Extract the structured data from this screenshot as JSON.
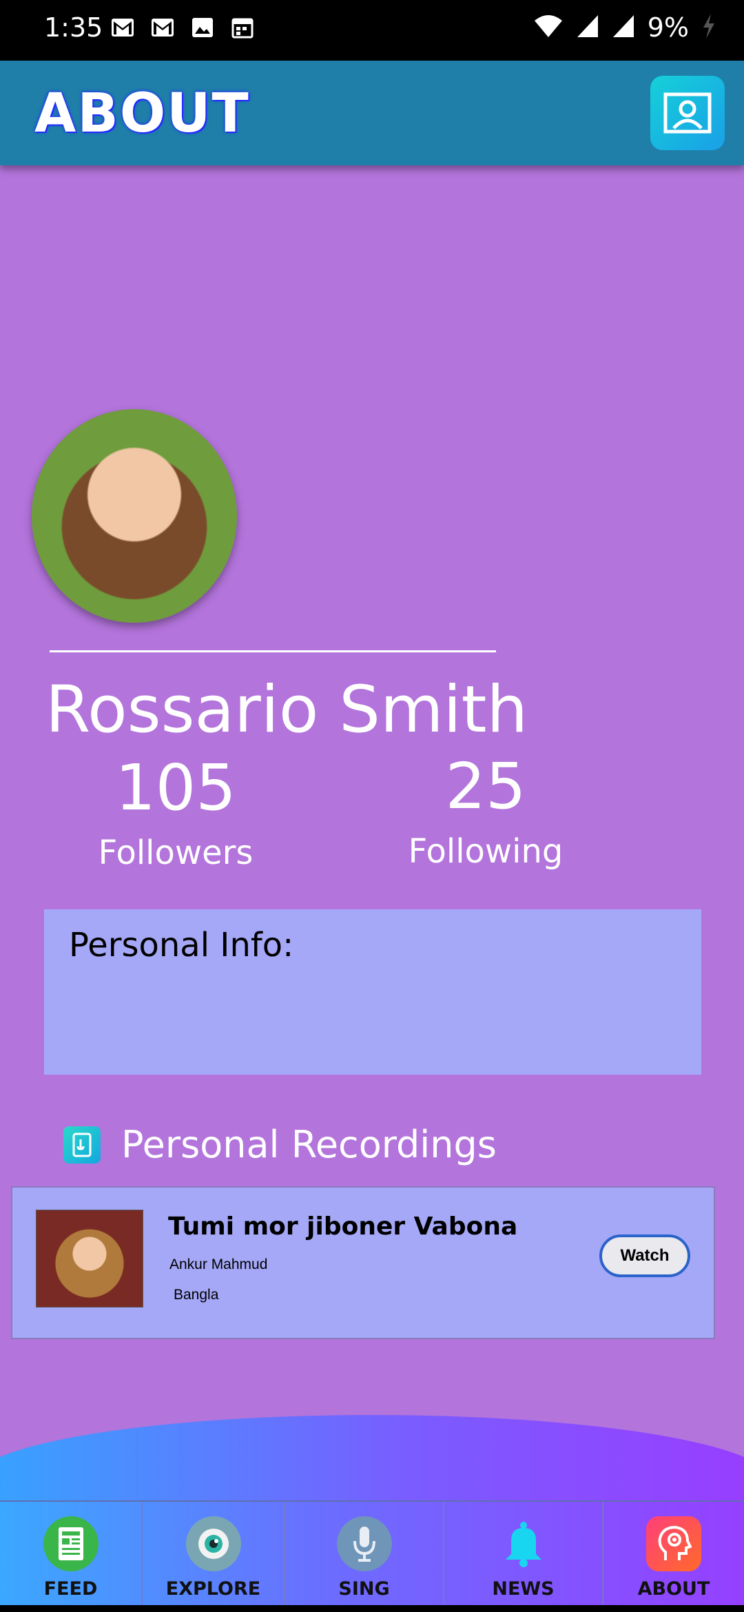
{
  "status_bar": {
    "time": "1:35",
    "battery": "9%"
  },
  "app_bar": {
    "title": "ABOUT"
  },
  "profile": {
    "name": "Rossario Smith",
    "followers_count": "105",
    "followers_label": "Followers",
    "following_count": "25",
    "following_label": "Following"
  },
  "personal_info": {
    "title": "Personal Info:"
  },
  "recordings": {
    "title": "Personal Recordings",
    "items": [
      {
        "song": "Tumi mor jiboner Vabona",
        "artist": "Ankur Mahmud",
        "language": "Bangla",
        "action": "Watch"
      }
    ]
  },
  "bottom_nav": {
    "items": [
      {
        "label": "FEED",
        "icon": "feed-icon"
      },
      {
        "label": "EXPLORE",
        "icon": "eye-icon"
      },
      {
        "label": "SING",
        "icon": "microphone-icon"
      },
      {
        "label": "NEWS",
        "icon": "bell-icon"
      },
      {
        "label": "ABOUT",
        "icon": "head-gear-icon"
      }
    ]
  },
  "colors": {
    "background": "#b374db",
    "app_bar": "#1f7fa8",
    "card": "#a5a8f7",
    "accent_button_border": "#2a63c9"
  }
}
